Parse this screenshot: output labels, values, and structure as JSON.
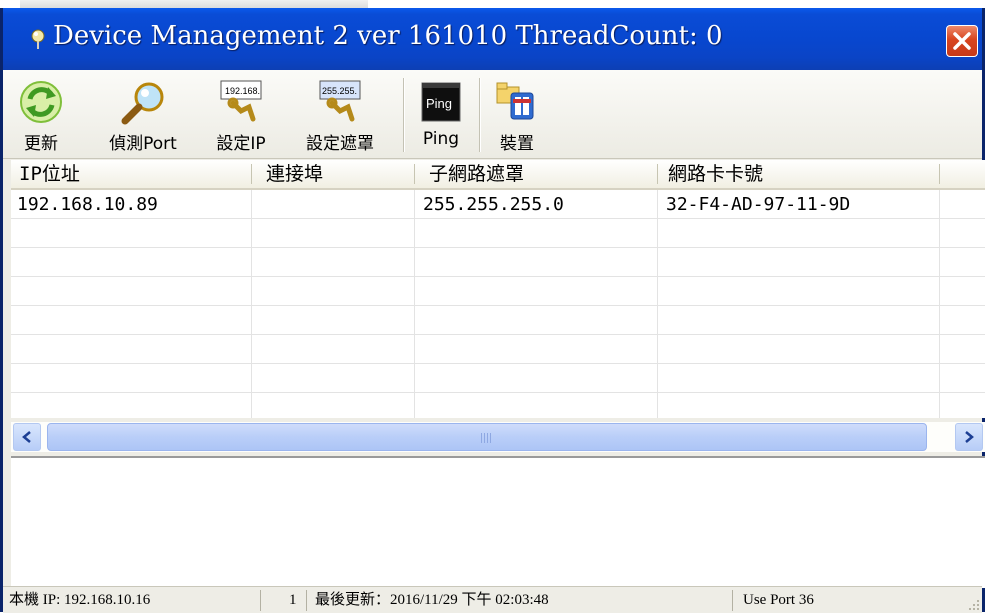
{
  "window": {
    "title": "Device Management 2 ver 161010  ThreadCount: 0",
    "close_icon": "close-icon",
    "app_icon": "pin-icon"
  },
  "toolbar": {
    "buttons": [
      {
        "label": "更新",
        "icon": "refresh-icon"
      },
      {
        "label": "偵測Port",
        "icon": "magnifier-icon"
      },
      {
        "label": "設定IP",
        "icon": "set-ip-icon",
        "icon_text": "192.168."
      },
      {
        "label": "設定遮罩",
        "icon": "set-mask-icon",
        "icon_text": "255.255."
      },
      {
        "label": "Ping",
        "icon": "ping-icon",
        "icon_text": "Ping"
      },
      {
        "label": "裝置",
        "icon": "device-icon"
      }
    ]
  },
  "table": {
    "columns": [
      "IP位址",
      "連接埠",
      "子網路遮罩",
      "網路卡卡號"
    ],
    "rows": [
      [
        "192.168.10.89",
        "",
        "255.255.255.0",
        "32-F4-AD-97-11-9D"
      ]
    ]
  },
  "scrollbar": {
    "grip_text": "III"
  },
  "statusbar": {
    "local_ip": "本機 IP: 192.168.10.16",
    "count": "1",
    "last_update": "最後更新：2016/11/29 下午 02:03:48",
    "port": "Use Port 36"
  },
  "colors": {
    "titlebar": "#0a4cd6",
    "close_button": "#d8451f",
    "scrollbar": "#b9cef8"
  }
}
